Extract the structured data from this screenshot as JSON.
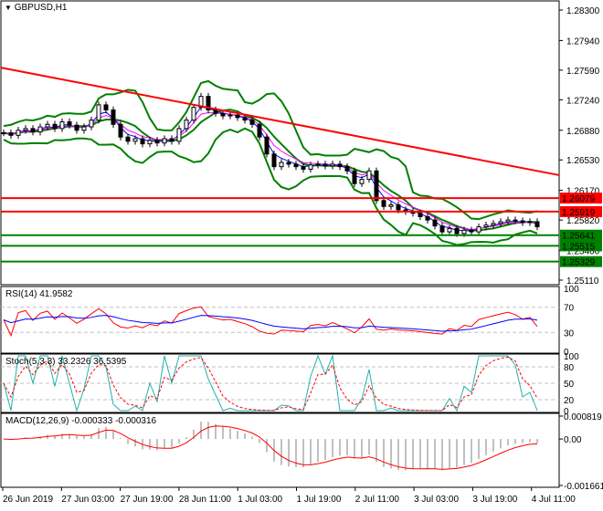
{
  "symbol_title": "GBPUSD,H1",
  "colors": {
    "bull": "#000000",
    "trend": "#ff0000",
    "bands": "#008000",
    "rsi": "#ff0000",
    "rsi_ma": "#0000ff",
    "stoch_main": "#20b2aa",
    "stoch_signal": "#ff0000",
    "macd_hist": "#c0c0c0",
    "macd_signal": "#ff0000"
  },
  "price_axis": {
    "ticks": [
      "1.28300",
      "1.27940",
      "1.27590",
      "1.27240",
      "1.26880",
      "1.26530",
      "1.26170",
      "1.25820",
      "1.25460",
      "1.25110"
    ],
    "range": [
      1.2511,
      1.283
    ]
  },
  "levels": [
    {
      "value": 1.26079,
      "label": "1.26079",
      "color": "#ff0000"
    },
    {
      "value": 1.25919,
      "label": "1.25919",
      "color": "#ff0000"
    },
    {
      "value": 1.25641,
      "label": "1.25641",
      "color": "#008000"
    },
    {
      "value": 1.25515,
      "label": "1.25515",
      "color": "#008000"
    },
    {
      "value": 1.25329,
      "label": "1.25329",
      "color": "#008000"
    }
  ],
  "trendline": {
    "start": 1.2762,
    "end": 1.2635
  },
  "closes": [
    1.2685,
    1.2682,
    1.2688,
    1.269,
    1.2686,
    1.2692,
    1.2695,
    1.269,
    1.2698,
    1.2694,
    1.2688,
    1.2692,
    1.27,
    1.2718,
    1.2712,
    1.2695,
    1.268,
    1.2675,
    1.2678,
    1.2672,
    1.2676,
    1.2673,
    1.2678,
    1.2675,
    1.269,
    1.27,
    1.2715,
    1.2728,
    1.2712,
    1.2708,
    1.2705,
    1.2706,
    1.2703,
    1.27,
    1.2695,
    1.268,
    1.266,
    1.2645,
    1.265,
    1.2648,
    1.2645,
    1.2642,
    1.2647,
    1.2648,
    1.2646,
    1.2648,
    1.2645,
    1.264,
    1.2625,
    1.263,
    1.264,
    1.2605,
    1.2598,
    1.26,
    1.2594,
    1.2592,
    1.259,
    1.2586,
    1.2582,
    1.2575,
    1.2568,
    1.2572,
    1.2566,
    1.257,
    1.2568,
    1.2574,
    1.2576,
    1.2578,
    1.258,
    1.2582,
    1.2581,
    1.2579,
    1.258,
    1.2574
  ],
  "rsi": {
    "label": "RSI(14) 41.9582",
    "ticks": [
      "100",
      "70",
      "30",
      "0"
    ],
    "levels": [
      70,
      30
    ]
  },
  "stoch": {
    "label": "Stoch(5,3,3) 33.2326 36.5395",
    "ticks": [
      "100",
      "80",
      "50",
      "20",
      "0"
    ],
    "levels": [
      80,
      50,
      20
    ]
  },
  "macd": {
    "label": "MACD(12,26,9) -0.000333 -0.000316",
    "ticks": [
      "0.000819",
      "0.00",
      "-0.001661"
    ],
    "range": [
      -0.001661,
      0.000819
    ]
  },
  "time_axis": [
    "26 Jun 2019",
    "27 Jun 03:00",
    "27 Jun 19:00",
    "28 Jun 11:00",
    "1 Jul 03:00",
    "1 Jul 19:00",
    "2 Jul 11:00",
    "3 Jul 03:00",
    "3 Jul 19:00",
    "4 Jul 11:00"
  ]
}
